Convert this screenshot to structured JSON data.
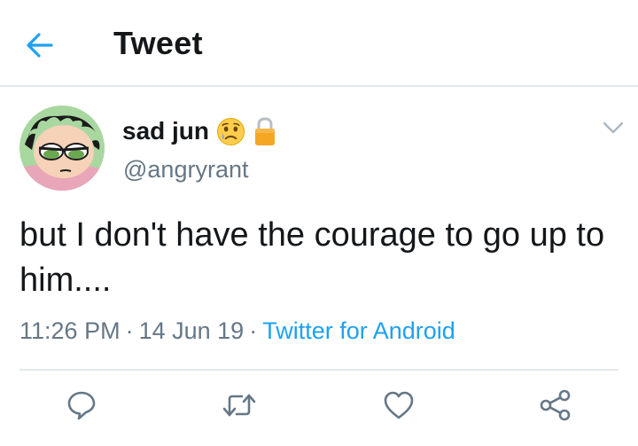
{
  "header": {
    "title": "Tweet",
    "back_icon": "arrow-left-icon"
  },
  "tweet": {
    "author": {
      "display_name": "sad jun",
      "handle": "@angryrant",
      "emoji_icon": "sad-face-emoji",
      "protected_icon": "lock-icon"
    },
    "text": "but I don't have the courage to go up to him....",
    "time": "11:26 PM",
    "date": "14 Jun 19",
    "source": "Twitter for Android",
    "separator": "·"
  },
  "actions": {
    "reply_icon": "reply-icon",
    "retweet_icon": "retweet-icon",
    "like_icon": "heart-icon",
    "share_icon": "share-icon",
    "more_icon": "chevron-down-icon"
  },
  "colors": {
    "accent": "#1da1f2",
    "text": "#14171a",
    "secondary": "#657786",
    "divider": "#e1e8ed",
    "lock": "#f5a623"
  }
}
